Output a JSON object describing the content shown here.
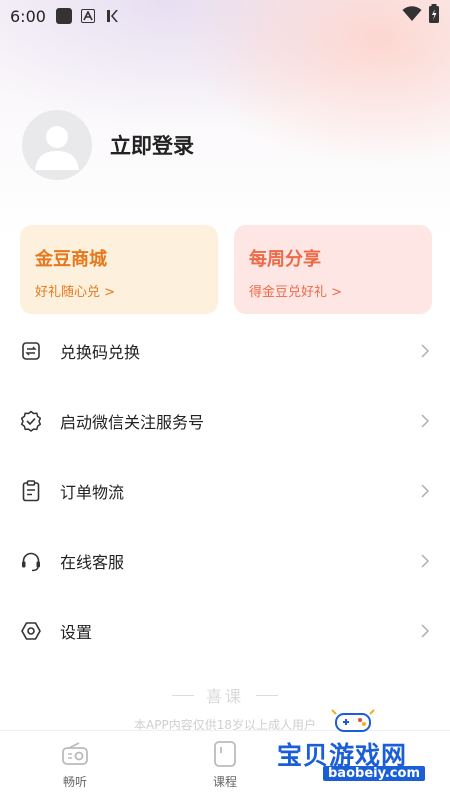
{
  "status_bar": {
    "time": "6:00",
    "icons": [
      "notification-square-icon",
      "a-letter-icon",
      "k-letter-icon",
      "wifi-icon",
      "battery-icon"
    ]
  },
  "profile": {
    "avatar_icon": "default-avatar-icon",
    "login_label": "立即登录"
  },
  "cards": [
    {
      "title": "金豆商城",
      "subtitle": "好礼随心兑 >",
      "color": "#e8781d"
    },
    {
      "title": "每周分享",
      "subtitle": "得金豆兑好礼 >",
      "color": "#ee6a47"
    }
  ],
  "menu": [
    {
      "label": "兑换码兑换",
      "icon": "exchange-icon"
    },
    {
      "label": "启动微信关注服务号",
      "icon": "badge-check-icon"
    },
    {
      "label": "订单物流",
      "icon": "clipboard-icon"
    },
    {
      "label": "在线客服",
      "icon": "headset-icon"
    },
    {
      "label": "设置",
      "icon": "settings-icon"
    }
  ],
  "footer": {
    "brand": "喜课",
    "disclaimer": "本APP内容仅供18岁以上成人用户"
  },
  "bottom_nav": [
    {
      "label": "畅听",
      "icon": "radio-icon"
    },
    {
      "label": "课程",
      "icon": "course-icon"
    },
    {
      "label": "",
      "icon": "profile-icon"
    }
  ],
  "watermark": {
    "text": "宝贝游戏网",
    "url": "baobeiy.com"
  },
  "colors": {
    "accent_orange": "#e8781d",
    "accent_coral": "#ee6a47",
    "gold_card_bg": "#fdf0dc",
    "share_card_bg": "#fde6e4"
  }
}
